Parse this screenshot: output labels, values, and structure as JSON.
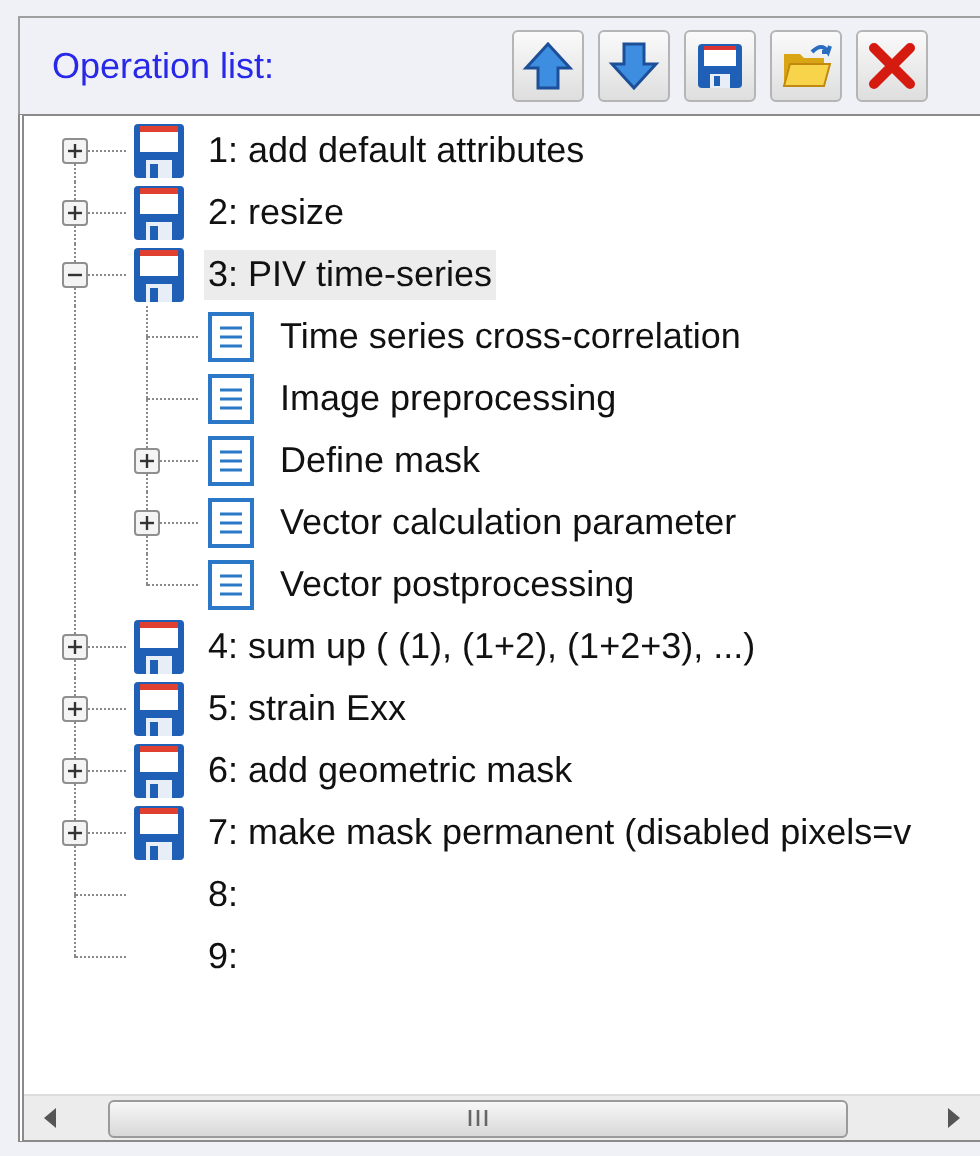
{
  "panel": {
    "title": "Operation list:"
  },
  "toolbar": [
    {
      "kind": "up"
    },
    {
      "kind": "down"
    },
    {
      "kind": "save"
    },
    {
      "kind": "open"
    },
    {
      "kind": "delete"
    }
  ],
  "tree": [
    {
      "label": "1: add default attributes",
      "kind": "operation",
      "expanded": false,
      "selected": false
    },
    {
      "label": "2: resize",
      "kind": "operation",
      "expanded": false,
      "selected": false
    },
    {
      "label": "3: PIV time-series",
      "kind": "operation",
      "expanded": true,
      "selected": true,
      "children": [
        {
          "label": "Time series cross-correlation",
          "kind": "step",
          "selected": false
        },
        {
          "label": "Image preprocessing",
          "kind": "step",
          "selected": false
        },
        {
          "label": "Define mask",
          "kind": "step",
          "expanded": false,
          "selected": false
        },
        {
          "label": "Vector calculation parameter",
          "kind": "step",
          "expanded": false,
          "selected": false
        },
        {
          "label": "Vector postprocessing",
          "kind": "step",
          "selected": false
        }
      ]
    },
    {
      "label": "4: sum up ( (1), (1+2), (1+2+3), ...)",
      "kind": "operation",
      "expanded": false,
      "selected": false
    },
    {
      "label": "5: strain Exx",
      "kind": "operation",
      "expanded": false,
      "selected": false
    },
    {
      "label": "6: add geometric mask",
      "kind": "operation",
      "expanded": false,
      "selected": false
    },
    {
      "label": "7: make mask permanent (disabled pixels=v",
      "kind": "operation",
      "expanded": false,
      "selected": false
    },
    {
      "label": "8:",
      "kind": "empty",
      "selected": false
    },
    {
      "label": "9:",
      "kind": "empty",
      "selected": false
    }
  ]
}
